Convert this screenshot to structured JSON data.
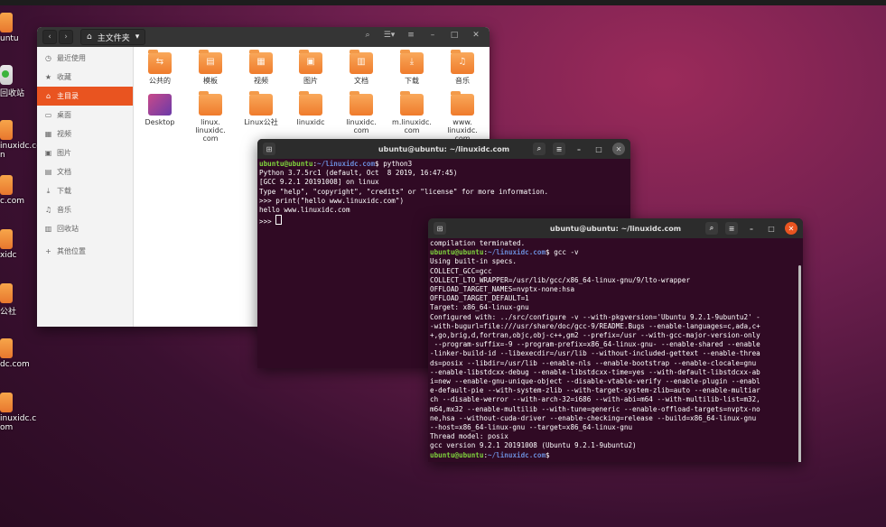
{
  "topbar": {
    "title": ""
  },
  "desktop": {
    "items": [
      {
        "label": "untu",
        "type": "folder"
      },
      {
        "label": "回收站",
        "type": "trash"
      },
      {
        "label": "inuxidc.co",
        "sub": "n",
        "type": "folder"
      },
      {
        "label": "c.com",
        "type": "folder"
      },
      {
        "label": "xidc",
        "type": "folder"
      },
      {
        "label": "公社",
        "type": "folder"
      },
      {
        "label": "dc.com",
        "type": "folder"
      },
      {
        "label": "inuxidc.c",
        "sub": "om",
        "type": "folder"
      }
    ]
  },
  "file_manager": {
    "path_label": "主文件夹",
    "sidebar": [
      {
        "label": "最近使用",
        "icon": "clock-icon"
      },
      {
        "label": "收藏",
        "icon": "star-icon"
      },
      {
        "label": "主目录",
        "icon": "home-icon",
        "active": true
      },
      {
        "label": "桌面",
        "icon": "desktop-icon"
      },
      {
        "label": "视频",
        "icon": "video-icon"
      },
      {
        "label": "图片",
        "icon": "image-icon"
      },
      {
        "label": "文档",
        "icon": "document-icon"
      },
      {
        "label": "下载",
        "icon": "download-icon"
      },
      {
        "label": "音乐",
        "icon": "music-icon"
      },
      {
        "label": "回收站",
        "icon": "trash-icon"
      },
      {
        "label": "其他位置",
        "icon": "plus-icon"
      }
    ],
    "files": [
      {
        "label": "公共的",
        "glyph": "⇆"
      },
      {
        "label": "模板",
        "glyph": "▤"
      },
      {
        "label": "视频",
        "glyph": "▦"
      },
      {
        "label": "图片",
        "glyph": "▣"
      },
      {
        "label": "文档",
        "glyph": "▥"
      },
      {
        "label": "下载",
        "glyph": "⤓"
      },
      {
        "label": "音乐",
        "glyph": "♫"
      },
      {
        "label": "Desktop",
        "glyph": ""
      },
      {
        "label": "linux.\nlinuxidc.\ncom",
        "glyph": ""
      },
      {
        "label": "Linux公社",
        "glyph": ""
      },
      {
        "label": "linuxidc",
        "glyph": ""
      },
      {
        "label": "linuxidc.\ncom",
        "glyph": ""
      },
      {
        "label": "m.linuxidc.\ncom",
        "glyph": ""
      },
      {
        "label": "www.\nlinuxidc.\ncom",
        "glyph": ""
      }
    ]
  },
  "terminal1": {
    "title": "ubuntu@ubuntu: ~/linuxidc.com",
    "prompt_user": "ubuntu@ubuntu",
    "prompt_path": "~/linuxidc.com",
    "command": "python3",
    "output": [
      "Python 3.7.5rc1 (default, Oct  8 2019, 16:47:45)",
      "[GCC 9.2.1 20191008] on linux",
      "Type \"help\", \"copyright\", \"credits\" or \"license\" for more information.",
      ">>> print(\"hello www.linuxidc.com\")",
      "hello www.linuxidc.com"
    ],
    "repl_prompt": ">>> "
  },
  "terminal2": {
    "title": "ubuntu@ubuntu: ~/linuxidc.com",
    "first_line": "compilation terminated.",
    "prompt_user": "ubuntu@ubuntu",
    "prompt_path": "~/linuxidc.com",
    "command": "gcc -v",
    "output": [
      "Using built-in specs.",
      "COLLECT_GCC=gcc",
      "COLLECT_LTO_WRAPPER=/usr/lib/gcc/x86_64-linux-gnu/9/lto-wrapper",
      "OFFLOAD_TARGET_NAMES=nvptx-none:hsa",
      "OFFLOAD_TARGET_DEFAULT=1",
      "Target: x86_64-linux-gnu",
      "Configured with: ../src/configure -v --with-pkgversion='Ubuntu 9.2.1-9ubuntu2' -",
      "-with-bugurl=file:///usr/share/doc/gcc-9/README.Bugs --enable-languages=c,ada,c+",
      "+,go,brig,d,fortran,objc,obj-c++,gm2 --prefix=/usr --with-gcc-major-version-only",
      " --program-suffix=-9 --program-prefix=x86_64-linux-gnu- --enable-shared --enable",
      "-linker-build-id --libexecdir=/usr/lib --without-included-gettext --enable-threa",
      "ds=posix --libdir=/usr/lib --enable-nls --enable-bootstrap --enable-clocale=gnu",
      "--enable-libstdcxx-debug --enable-libstdcxx-time=yes --with-default-libstdcxx-ab",
      "i=new --enable-gnu-unique-object --disable-vtable-verify --enable-plugin --enabl",
      "e-default-pie --with-system-zlib --with-target-system-zlib=auto --enable-multiar",
      "ch --disable-werror --with-arch-32=i686 --with-abi=m64 --with-multilib-list=m32,",
      "m64,mx32 --enable-multilib --with-tune=generic --enable-offload-targets=nvptx-no",
      "ne,hsa --without-cuda-driver --enable-checking=release --build=x86_64-linux-gnu",
      "--host=x86_64-linux-gnu --target=x86_64-linux-gnu",
      "Thread model: posix",
      "gcc version 9.2.1 20191008 (Ubuntu 9.2.1-9ubuntu2)"
    ]
  },
  "symbols": {
    "prompt_colon": ":",
    "prompt_dollar": "$ ",
    "prompt_dollar_end": "$"
  }
}
